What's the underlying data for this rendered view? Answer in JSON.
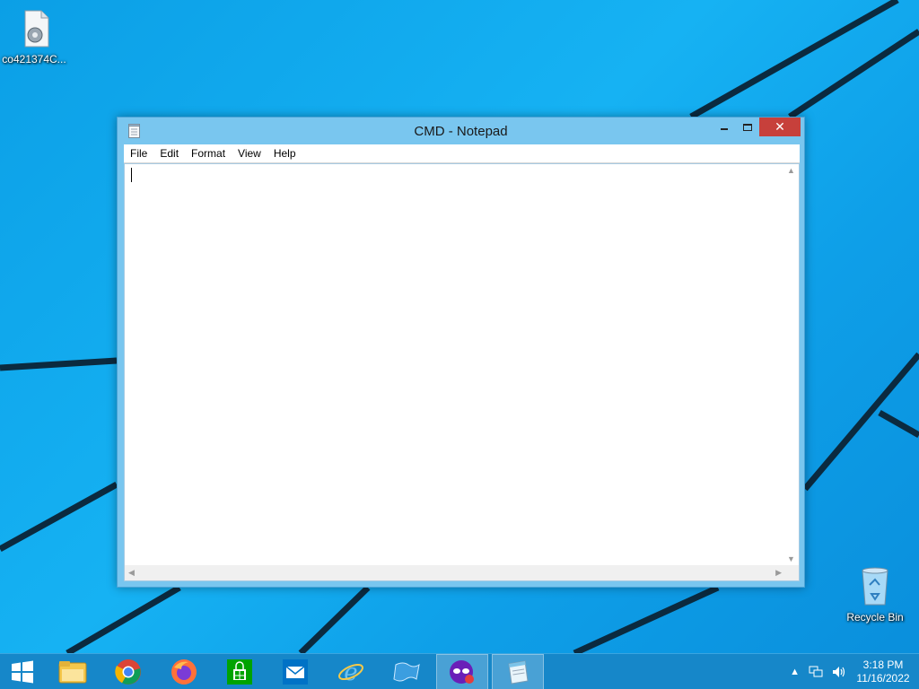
{
  "desktop": {
    "icons": [
      {
        "label": "co421374C...",
        "icon": "settings-file-icon"
      },
      {
        "label": "Recycle Bin",
        "icon": "recycle-bin-icon"
      }
    ]
  },
  "window": {
    "title": "CMD - Notepad",
    "close_glyph": "✕",
    "menu": [
      "File",
      "Edit",
      "Format",
      "View",
      "Help"
    ],
    "content": ""
  },
  "taskbar": {
    "items": [
      {
        "name": "start-button",
        "icon": "windows-logo-icon"
      },
      {
        "name": "file-explorer",
        "icon": "folder-icon"
      },
      {
        "name": "chrome",
        "icon": "chrome-icon"
      },
      {
        "name": "firefox",
        "icon": "firefox-icon"
      },
      {
        "name": "store",
        "icon": "store-icon"
      },
      {
        "name": "mail",
        "icon": "mail-icon"
      },
      {
        "name": "internet-explorer",
        "icon": "ie-icon"
      },
      {
        "name": "unknown-app",
        "icon": "flag-icon"
      },
      {
        "name": "mask-app",
        "icon": "mask-icon",
        "active": true
      },
      {
        "name": "notepad",
        "icon": "notepad-icon",
        "active": true
      }
    ],
    "tray": {
      "show_hidden": "▲",
      "time": "3:18 PM",
      "date": "11/16/2022"
    }
  },
  "colors": {
    "desktop": "#0aa5ee",
    "taskbar": "#1687c9",
    "window_frame": "#79c6ef",
    "close_button": "#c7403b"
  }
}
